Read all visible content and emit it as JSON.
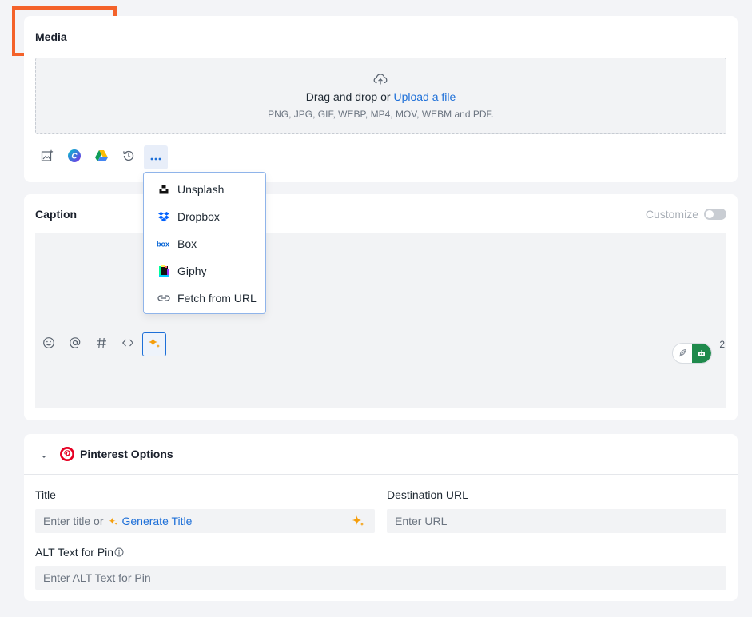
{
  "colors": {
    "accent": "#1d6fd8",
    "highlight": "#f4622a",
    "pinterest": "#e60023",
    "ai_green": "#1f8a4c"
  },
  "media": {
    "title": "Media",
    "dropzone": {
      "icon": "cloud-upload-icon",
      "prompt": "Drag and drop or",
      "link": "Upload a file",
      "formats": "PNG, JPG, GIF, WEBP, MP4, MOV, WEBM and PDF."
    },
    "toolbar": [
      "image-add-icon",
      "canva-icon",
      "google-drive-icon",
      "history-icon",
      "more-icon"
    ]
  },
  "dropdown": {
    "items": [
      {
        "label": "Unsplash",
        "icon": "unsplash-icon"
      },
      {
        "label": "Dropbox",
        "icon": "dropbox-icon"
      },
      {
        "label": "Box",
        "icon": "box-icon"
      },
      {
        "label": "Giphy",
        "icon": "giphy-icon"
      },
      {
        "label": "Fetch from URL",
        "icon": "link-icon"
      }
    ]
  },
  "caption": {
    "title": "Caption",
    "customize_label": "Customize",
    "customize_on": false,
    "toolbar": [
      "emoji-icon",
      "mention-icon",
      "hashtag-icon",
      "code-icon",
      "ai-sparkle-icon"
    ],
    "char_count": "2"
  },
  "pinterest": {
    "title": "Pinterest Options",
    "title_label": "Title",
    "title_placeholder": "Enter title or",
    "generate_title": "Generate Title",
    "destination_label": "Destination URL",
    "destination_placeholder": "Enter URL",
    "alt_label": "ALT Text for Pin",
    "alt_placeholder": "Enter ALT Text for Pin"
  }
}
